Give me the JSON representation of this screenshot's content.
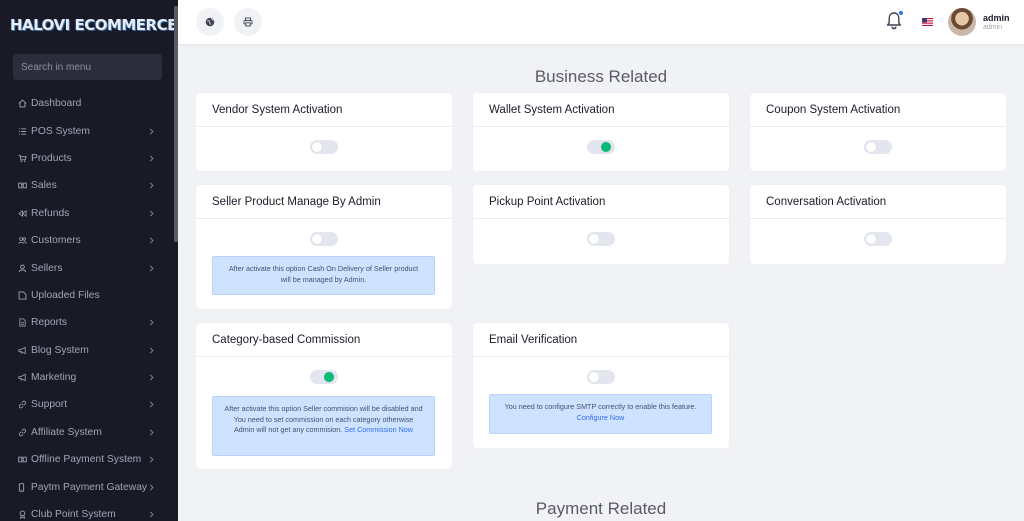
{
  "app": {
    "logo_text": "HALOVI ECOMMERCE CMS"
  },
  "sidebar": {
    "search_placeholder": "Search in menu",
    "items": [
      {
        "label": "Dashboard",
        "icon": "home-icon",
        "has_children": false
      },
      {
        "label": "POS System",
        "icon": "list-icon",
        "has_children": true
      },
      {
        "label": "Products",
        "icon": "cart-icon",
        "has_children": true
      },
      {
        "label": "Sales",
        "icon": "money-icon",
        "has_children": true
      },
      {
        "label": "Refunds",
        "icon": "backward-icon",
        "has_children": true
      },
      {
        "label": "Customers",
        "icon": "users-icon",
        "has_children": true
      },
      {
        "label": "Sellers",
        "icon": "user-icon",
        "has_children": true
      },
      {
        "label": "Uploaded Files",
        "icon": "folder-icon",
        "has_children": false
      },
      {
        "label": "Reports",
        "icon": "file-icon",
        "has_children": true
      },
      {
        "label": "Blog System",
        "icon": "bullhorn-icon",
        "has_children": true
      },
      {
        "label": "Marketing",
        "icon": "bullhorn-icon",
        "has_children": true
      },
      {
        "label": "Support",
        "icon": "link-icon",
        "has_children": true
      },
      {
        "label": "Affiliate System",
        "icon": "link-icon",
        "has_children": true
      },
      {
        "label": "Offline Payment System",
        "icon": "money-icon",
        "has_children": true
      },
      {
        "label": "Paytm Payment Gateway",
        "icon": "mobile-icon",
        "has_children": true
      },
      {
        "label": "Club Point System",
        "icon": "award-icon",
        "has_children": true
      }
    ]
  },
  "topbar": {
    "user_name": "admin",
    "user_role": "admin"
  },
  "sections": {
    "business": "Business Related",
    "payment": "Payment Related"
  },
  "cards": {
    "vendor": {
      "title": "Vendor System Activation",
      "enabled": false
    },
    "wallet": {
      "title": "Wallet System Activation",
      "enabled": true
    },
    "coupon": {
      "title": "Coupon System Activation",
      "enabled": false
    },
    "seller_product": {
      "title": "Seller Product Manage By Admin",
      "enabled": false,
      "note": "After activate this option Cash On Delivery of Seller product will be managed by Admin."
    },
    "pickup": {
      "title": "Pickup Point Activation",
      "enabled": false
    },
    "conversation": {
      "title": "Conversation Activation",
      "enabled": false
    },
    "category_commission": {
      "title": "Category-based Commission",
      "enabled": true,
      "note": "After activate this option Seller commision will be disabled and You need to set commission on each category otherwise Admin will not get any commision.",
      "link": "Set Commission Now"
    },
    "email_verification": {
      "title": "Email Verification",
      "enabled": false,
      "note": "You need to configure SMTP correctly to enable this feature.",
      "link": "Configure Now"
    }
  },
  "colors": {
    "sidebar_bg": "#1a1a27",
    "toggle_on": "#0abb75",
    "alert_bg": "#cfe2ff",
    "accent": "#2e6ff2"
  }
}
